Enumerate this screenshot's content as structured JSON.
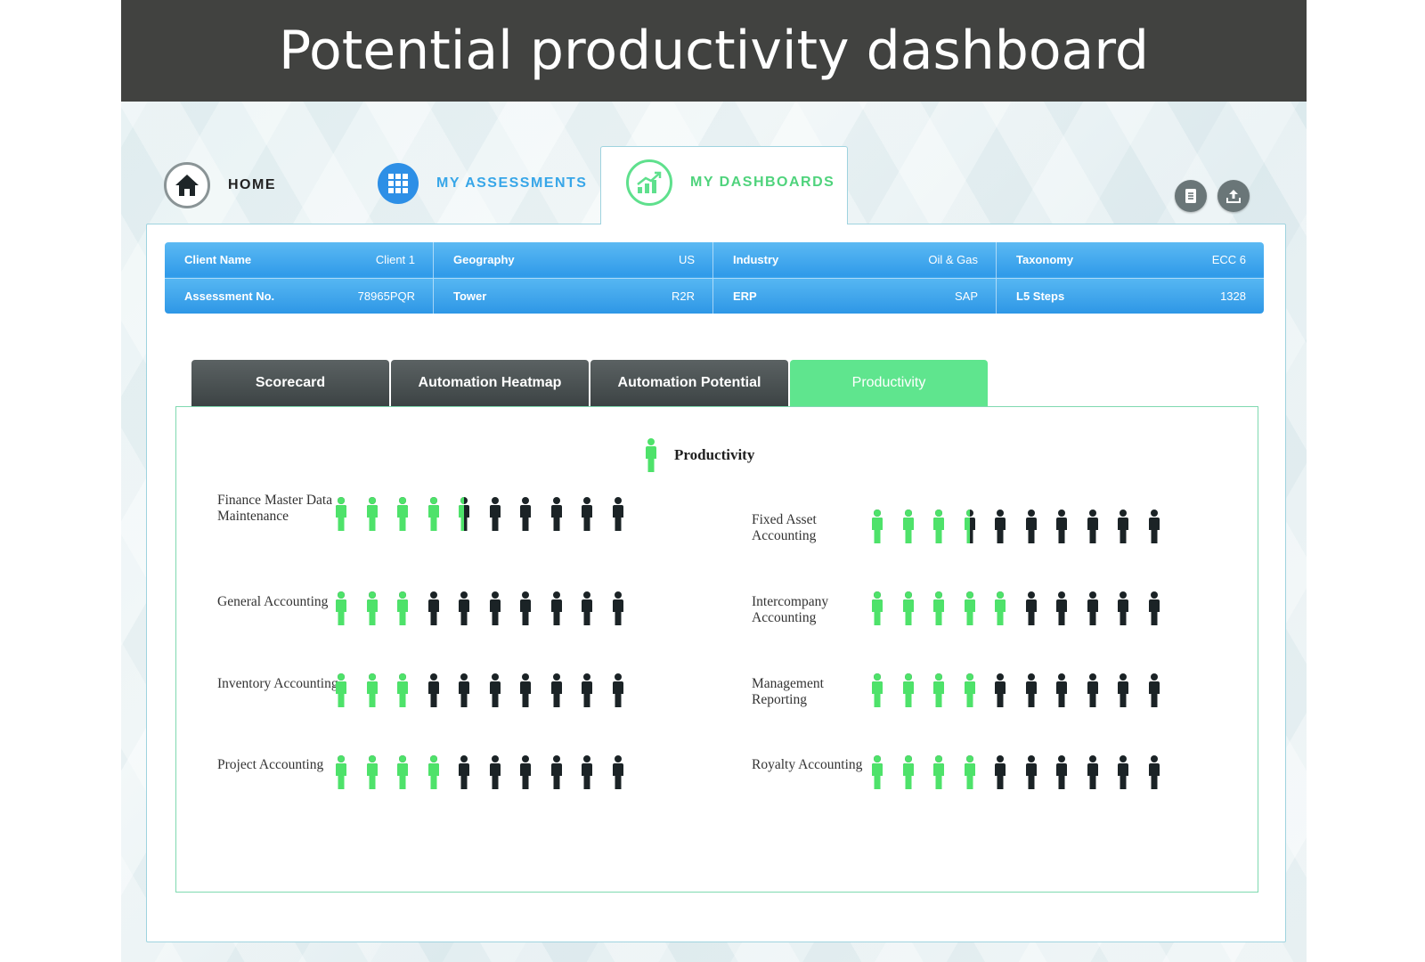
{
  "title": "Potential productivity dashboard",
  "nav": {
    "home": "HOME",
    "assessments": "MY ASSESSMENTS",
    "dashboards": "MY DASHBOARDS"
  },
  "info": [
    {
      "k1": "Client Name",
      "v1": "Client 1",
      "k2": "Assessment No.",
      "v2": "78965PQR"
    },
    {
      "k1": "Geography",
      "v1": "US",
      "k2": "Tower",
      "v2": "R2R"
    },
    {
      "k1": "Industry",
      "v1": "Oil & Gas",
      "k2": "ERP",
      "v2": "SAP"
    },
    {
      "k1": "Taxonomy",
      "v1": "ECC 6",
      "k2": "L5 Steps",
      "v2": "1328"
    }
  ],
  "tabs": [
    "Scorecard",
    "Automation Heatmap",
    "Automation Potential",
    "Productivity"
  ],
  "legend": "Productivity",
  "colors": {
    "green": "#4ee26a",
    "dark": "#1b2326"
  },
  "chart_data": {
    "type": "pictograph",
    "total_icons": 10,
    "legend": "Productivity",
    "rows": [
      {
        "label": "Finance Master Data Maintenance",
        "value": 4.5
      },
      {
        "label": "General Accounting",
        "value": 3
      },
      {
        "label": "Inventory Accounting",
        "value": 3
      },
      {
        "label": "Project Accounting",
        "value": 4
      },
      {
        "label": "Fixed Asset Accounting",
        "value": 3.5
      },
      {
        "label": "Intercompany Accounting",
        "value": 5
      },
      {
        "label": "Management Reporting",
        "value": 4
      },
      {
        "label": "Royalty Accounting",
        "value": 4
      }
    ]
  }
}
